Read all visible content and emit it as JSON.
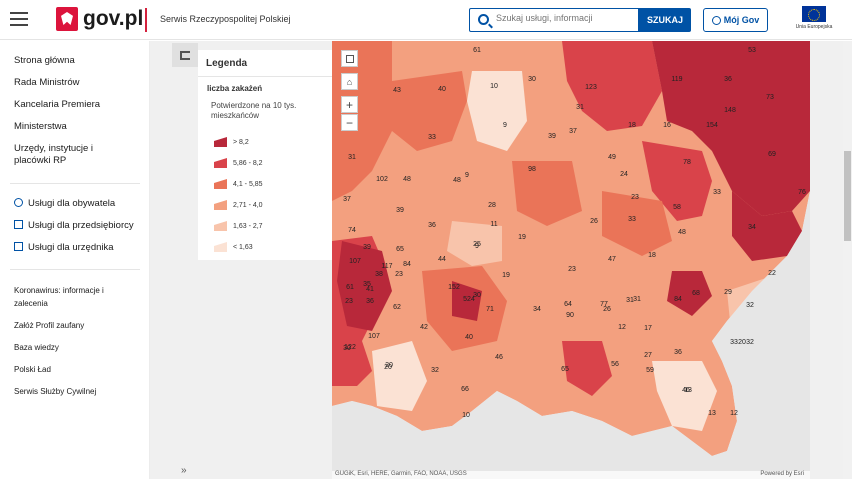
{
  "header": {
    "logo_text": "gov.pl",
    "service_name": "Serwis Rzeczypospolitej Polskiej",
    "search_placeholder": "Szukaj usługi, informacji",
    "search_button": "SZUKAJ",
    "account_button": "Mój Gov",
    "eu_label": "Unia Europejska"
  },
  "sidebar": {
    "items": [
      {
        "label": "Strona główna"
      },
      {
        "label": "Rada Ministrów"
      },
      {
        "label": "Kancelaria Premiera"
      },
      {
        "label": "Ministerstwa"
      },
      {
        "label": "Urzędy, instytucje i placówki RP"
      }
    ],
    "services": [
      {
        "label": "Usługi dla obywatela",
        "icon": "user-icon"
      },
      {
        "label": "Usługi dla przedsiębiorcy",
        "icon": "briefcase-icon"
      },
      {
        "label": "Usługi dla urzędnika",
        "icon": "id-card-icon"
      }
    ],
    "links": [
      {
        "label": "Koronawirus: informacje i zalecenia"
      },
      {
        "label": "Załóż Profil zaufany"
      },
      {
        "label": "Baza wiedzy"
      },
      {
        "label": "Polski Ład"
      },
      {
        "label": "Serwis Służby Cywilnej"
      }
    ]
  },
  "legend": {
    "title": "Legenda",
    "layer": "liczba zakażeń",
    "unit": "Potwierdzone na 10 tys. mieszkańców",
    "classes": [
      {
        "label": "> 8,2",
        "color": "#b8283a"
      },
      {
        "label": "5,86 - 8,2",
        "color": "#d9434a"
      },
      {
        "label": "4,1 - 5,85",
        "color": "#ea7458"
      },
      {
        "label": "2,71 - 4,0",
        "color": "#f3a07f"
      },
      {
        "label": "1,63 - 2,7",
        "color": "#f8c4ab"
      },
      {
        "label": "< 1,63",
        "color": "#fbe2d4"
      }
    ]
  },
  "map": {
    "controls": [
      "fullscreen-icon",
      "home-icon",
      "+",
      "−"
    ],
    "attribution": "GUGiK, Esri, HERE, Garmin, FAO, NOAA, USGS",
    "powered_by": "Powered by Esri",
    "labels": [
      "61",
      "53",
      "36",
      "30",
      "123",
      "119",
      "40",
      "10",
      "73",
      "148",
      "31",
      "154",
      "9",
      "39",
      "37",
      "18",
      "16",
      "62",
      "69",
      "43",
      "31",
      "33",
      "48",
      "9",
      "98",
      "49",
      "24",
      "78",
      "33",
      "76",
      "37",
      "102",
      "48",
      "39",
      "28",
      "23",
      "58",
      "74",
      "39",
      "65",
      "36",
      "11",
      "26",
      "25",
      "19",
      "33",
      "48",
      "34",
      "107",
      "84",
      "117",
      "9",
      "47",
      "18",
      "22",
      "38",
      "35",
      "36",
      "23",
      "44",
      "19",
      "23",
      "31",
      "26",
      "30",
      "61",
      "41",
      "152",
      "524",
      "71",
      "34",
      "64",
      "77",
      "31",
      "84",
      "68",
      "29",
      "32",
      "20",
      "23",
      "62",
      "42",
      "13",
      "90",
      "12",
      "107",
      "30",
      "20",
      "32",
      "40",
      "46",
      "17",
      "36",
      "27",
      "33",
      "32",
      "122",
      "20",
      "65",
      "56",
      "59",
      "66",
      "46",
      "13",
      "12",
      "10",
      "18"
    ]
  },
  "ui": {
    "expand_label": "»"
  }
}
